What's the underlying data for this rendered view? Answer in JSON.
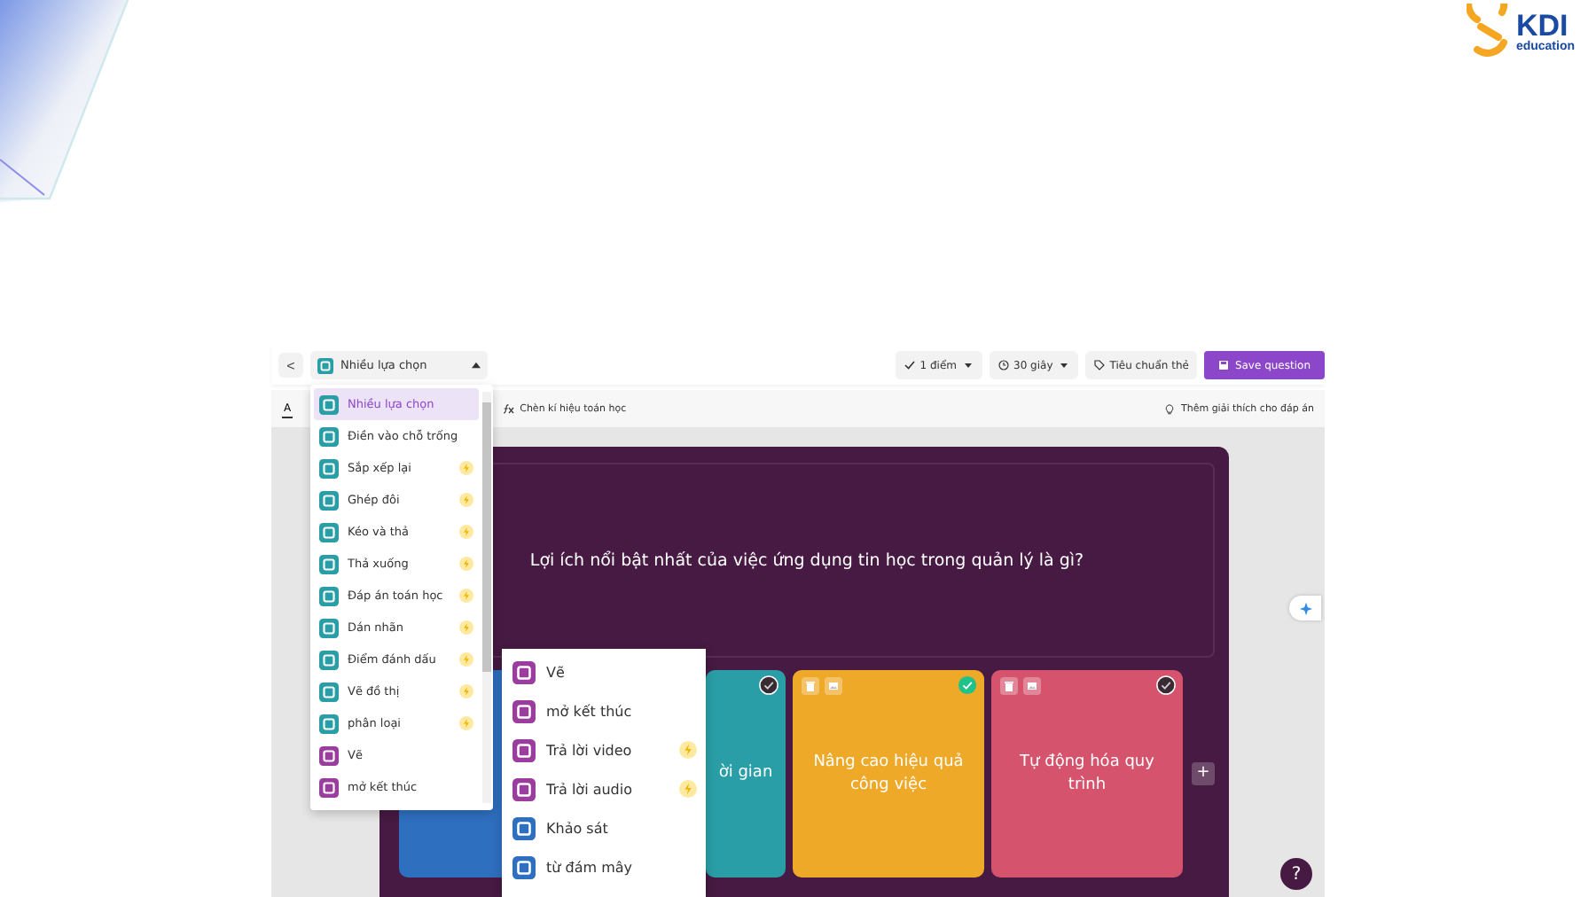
{
  "logo": {
    "name": "KDI",
    "tagline": "education"
  },
  "toolbar": {
    "back": "<",
    "question_type": "Nhiều lựa chọn",
    "points": "1 điểm",
    "time": "30 giây",
    "standards": "Tiêu chuẩn thẻ",
    "save": "Save question"
  },
  "format_bar": {
    "text_tab": "A",
    "math": "Chèn kí hiệu toán học",
    "explanation": "Thêm giải thích cho đáp án"
  },
  "question": "Lợi ích nổi bật nhất của việc ứng dụng tin học trong quản lý là gì?",
  "answers": [
    {
      "color": "#2f6fc0"
    },
    {
      "color": "#2a9ea6",
      "text": "ời gian",
      "correct": false
    },
    {
      "color": "#efa929",
      "text": "Nâng cao hiệu quả công việc",
      "correct": true
    },
    {
      "color": "#d5536c",
      "text": "Tự động hóa quy trình",
      "correct": false
    }
  ],
  "add_answer": "+",
  "help": "?",
  "type_menu": [
    {
      "label": "Nhiều lựa chọn",
      "color": "#2a9ea6",
      "premium": false,
      "selected": true
    },
    {
      "label": "Điền vào chỗ trống",
      "color": "#2a9ea6",
      "premium": false,
      "selected": false
    },
    {
      "label": "Sắp xếp lại",
      "color": "#2a9ea6",
      "premium": true,
      "selected": false
    },
    {
      "label": "Ghép đôi",
      "color": "#2a9ea6",
      "premium": true,
      "selected": false
    },
    {
      "label": "Kéo và thả",
      "color": "#2a9ea6",
      "premium": true,
      "selected": false
    },
    {
      "label": "Thả xuống",
      "color": "#2a9ea6",
      "premium": true,
      "selected": false
    },
    {
      "label": "Đáp án toán học",
      "color": "#2a9ea6",
      "premium": true,
      "selected": false
    },
    {
      "label": "Dán nhãn",
      "color": "#2a9ea6",
      "premium": true,
      "selected": false
    },
    {
      "label": "Điểm đánh dấu",
      "color": "#2a9ea6",
      "premium": true,
      "selected": false
    },
    {
      "label": "Vẽ đồ thị",
      "color": "#2a9ea6",
      "premium": true,
      "selected": false
    },
    {
      "label": "phân loại",
      "color": "#2a9ea6",
      "premium": true,
      "selected": false
    },
    {
      "label": "Vẽ",
      "color": "#9b3d9e",
      "premium": false,
      "selected": false
    },
    {
      "label": "mở kết thúc",
      "color": "#9b3d9e",
      "premium": false,
      "selected": false
    }
  ],
  "open_menu": [
    {
      "label": "Vẽ",
      "color": "#9b3d9e",
      "premium": false
    },
    {
      "label": "mở kết thúc",
      "color": "#9b3d9e",
      "premium": false
    },
    {
      "label": "Trả lời video",
      "color": "#9b3d9e",
      "premium": true
    },
    {
      "label": "Trả lời audio",
      "color": "#9b3d9e",
      "premium": true
    },
    {
      "label": "Khảo sát",
      "color": "#2f6fc0",
      "premium": false
    },
    {
      "label": "từ đám mây",
      "color": "#2f6fc0",
      "premium": false
    }
  ]
}
